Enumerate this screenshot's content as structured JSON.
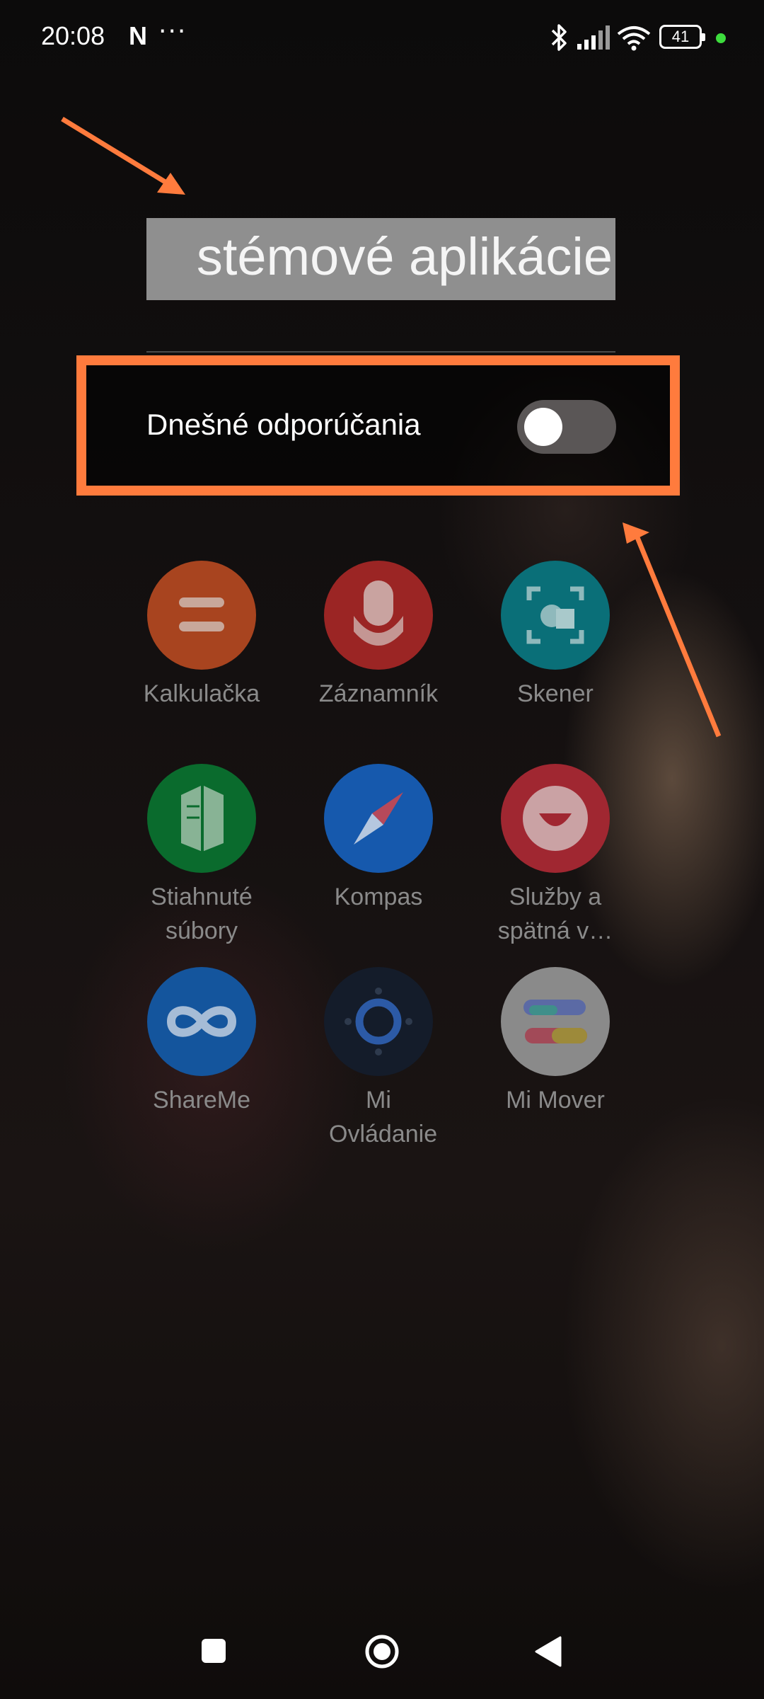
{
  "status_bar": {
    "time": "20:08",
    "notification_letter": "N",
    "more": "···",
    "battery": "41"
  },
  "search": {
    "title": "stémové aplikácie"
  },
  "recommendations": {
    "label": "Dnešné odporúčania",
    "enabled": false
  },
  "apps": [
    {
      "label": "Kalkulačka",
      "icon": "calculator-icon",
      "color": "#a8441f"
    },
    {
      "label": "Záznamník",
      "icon": "recorder-icon",
      "color": "#9b2524"
    },
    {
      "label": "Skener",
      "icon": "scanner-icon",
      "color": "#0a6f78"
    },
    {
      "label": "Stiahnuté súbory",
      "icon": "downloads-icon",
      "color": "#0a6b2d"
    },
    {
      "label": "Kompas",
      "icon": "compass-icon",
      "color": "#1659ad"
    },
    {
      "label": "Služby a spätná v…",
      "icon": "feedback-icon",
      "color": "#a02731"
    },
    {
      "label": "ShareMe",
      "icon": "shareme-icon",
      "color": "#14559d"
    },
    {
      "label": "Mi Ovládanie",
      "icon": "mi-remote-icon",
      "color": "#141c2a"
    },
    {
      "label": "Mi Mover",
      "icon": "mi-mover-icon",
      "color": "#8a8a8a"
    }
  ],
  "colors": {
    "annotation": "#ff7b3d"
  }
}
